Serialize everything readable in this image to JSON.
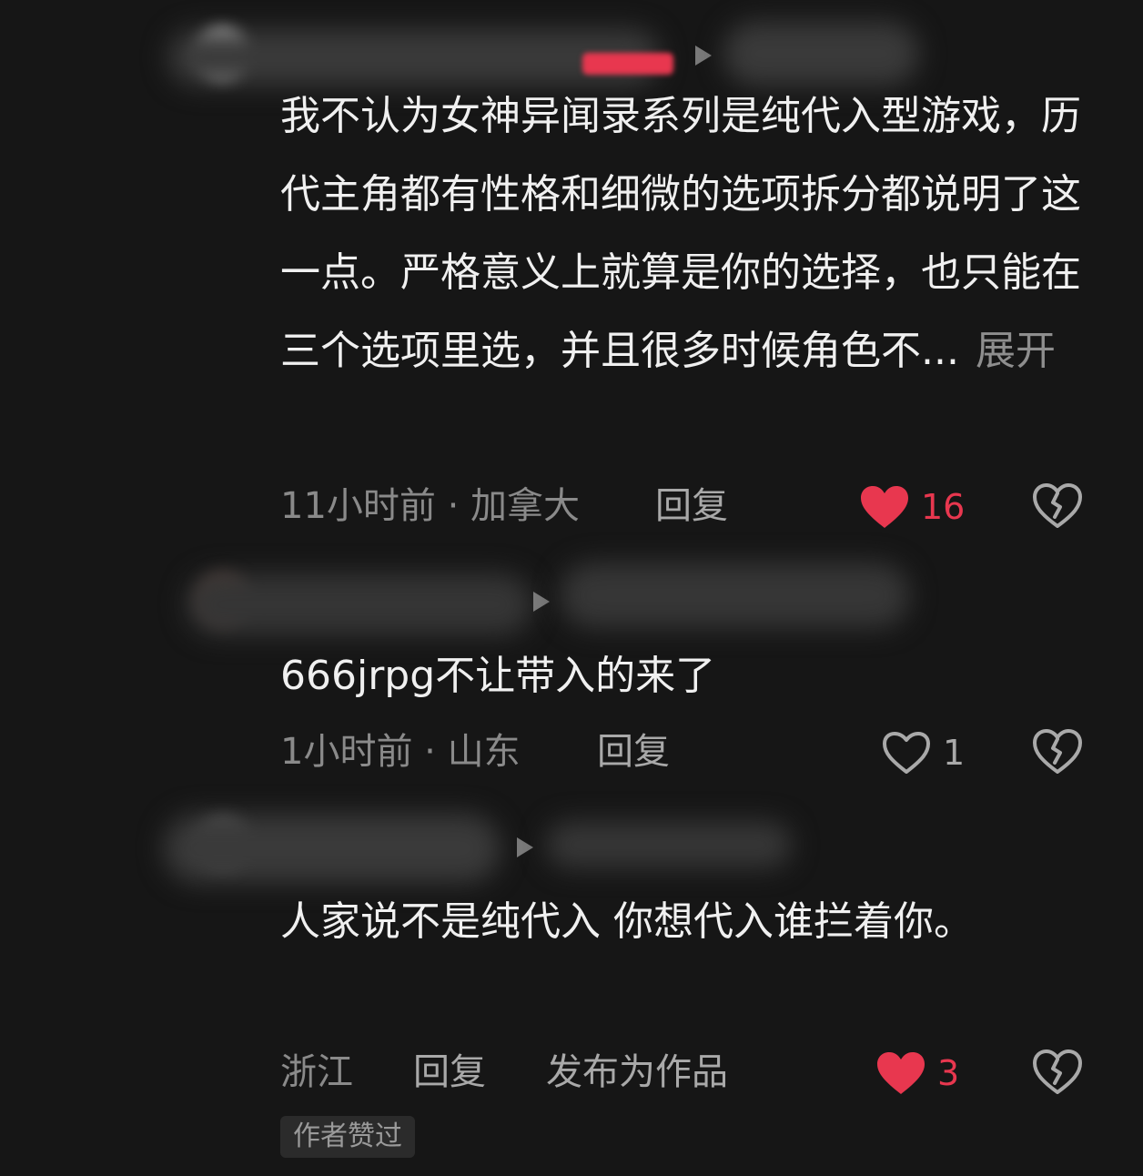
{
  "comments": [
    {
      "text": "我不认为女神异闻录系列是纯代入型游戏，历代主角都有性格和细微的选项拆分都说明了这一点。严格意义上就算是你的选择，也只能在三个选项里选，并且很多时候角色不...",
      "expand_label": "展开",
      "meta": "11小时前 · 加拿大",
      "reply_label": "回复",
      "likes": "16",
      "liked": true
    },
    {
      "text": "666jrpg不让带入的来了",
      "meta": "1小时前 · 山东",
      "reply_label": "回复",
      "likes": "1",
      "liked": false
    },
    {
      "text": "人家说不是纯代入 你想代入谁拦着你。",
      "meta": "浙江",
      "reply_label": "回复",
      "publish_label": "发布为作品",
      "likes": "3",
      "liked": true,
      "badge": "作者赞过"
    }
  ],
  "colors": {
    "background": "#161616",
    "like_active": "#e8374f",
    "muted_text": "#8a8a8a"
  },
  "icons": [
    "heart-icon",
    "broken-heart-icon",
    "play-arrow-icon"
  ]
}
